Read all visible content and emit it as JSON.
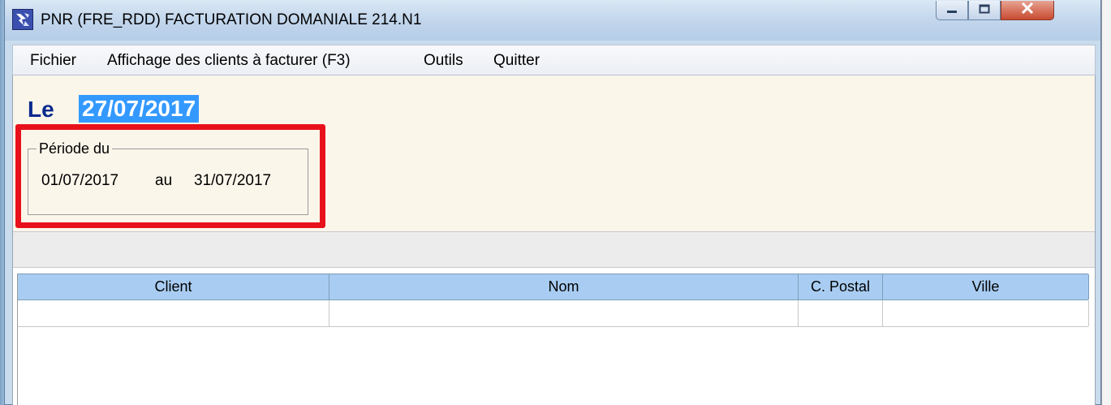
{
  "window": {
    "title": "PNR  (FRE_RDD) FACTURATION DOMANIALE 214.N1",
    "controls": {
      "minimize": "minimize-icon",
      "maximize": "maximize-icon",
      "close": "close-icon"
    }
  },
  "menu": {
    "items": [
      {
        "label": "Fichier"
      },
      {
        "label": "Affichage des clients à facturer (F3)"
      },
      {
        "label": "Outils"
      },
      {
        "label": "Quitter"
      }
    ]
  },
  "header": {
    "le_label": "Le",
    "date": "27/07/2017"
  },
  "periode": {
    "legend": "Période du",
    "from": "01/07/2017",
    "au": "au",
    "to": "31/07/2017"
  },
  "grid": {
    "columns": [
      "Client",
      "Nom",
      "C. Postal",
      "Ville"
    ],
    "rows": [
      [
        "",
        "",
        "",
        ""
      ]
    ]
  },
  "colors": {
    "highlight_box": "#e8111b",
    "date_selection": "#3399ff",
    "grid_header": "#a9cdf2",
    "form_background": "#fbf6ea"
  }
}
